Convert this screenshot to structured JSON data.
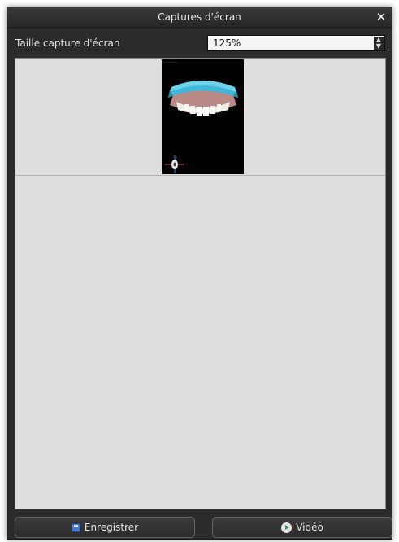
{
  "window": {
    "title": "Captures d'écran",
    "close_icon": "close-icon"
  },
  "screenshot_size": {
    "label": "Taille capture d'écran",
    "value": "125%"
  },
  "captures": [
    {
      "name": "dental-model-capture"
    }
  ],
  "buttons": {
    "save_label": "Enregistrer",
    "video_label": "Vidéo"
  },
  "colors": {
    "window_bg": "#2b2b2b",
    "canvas_bg": "#dedede",
    "model_cyan": "#41b8d8"
  }
}
